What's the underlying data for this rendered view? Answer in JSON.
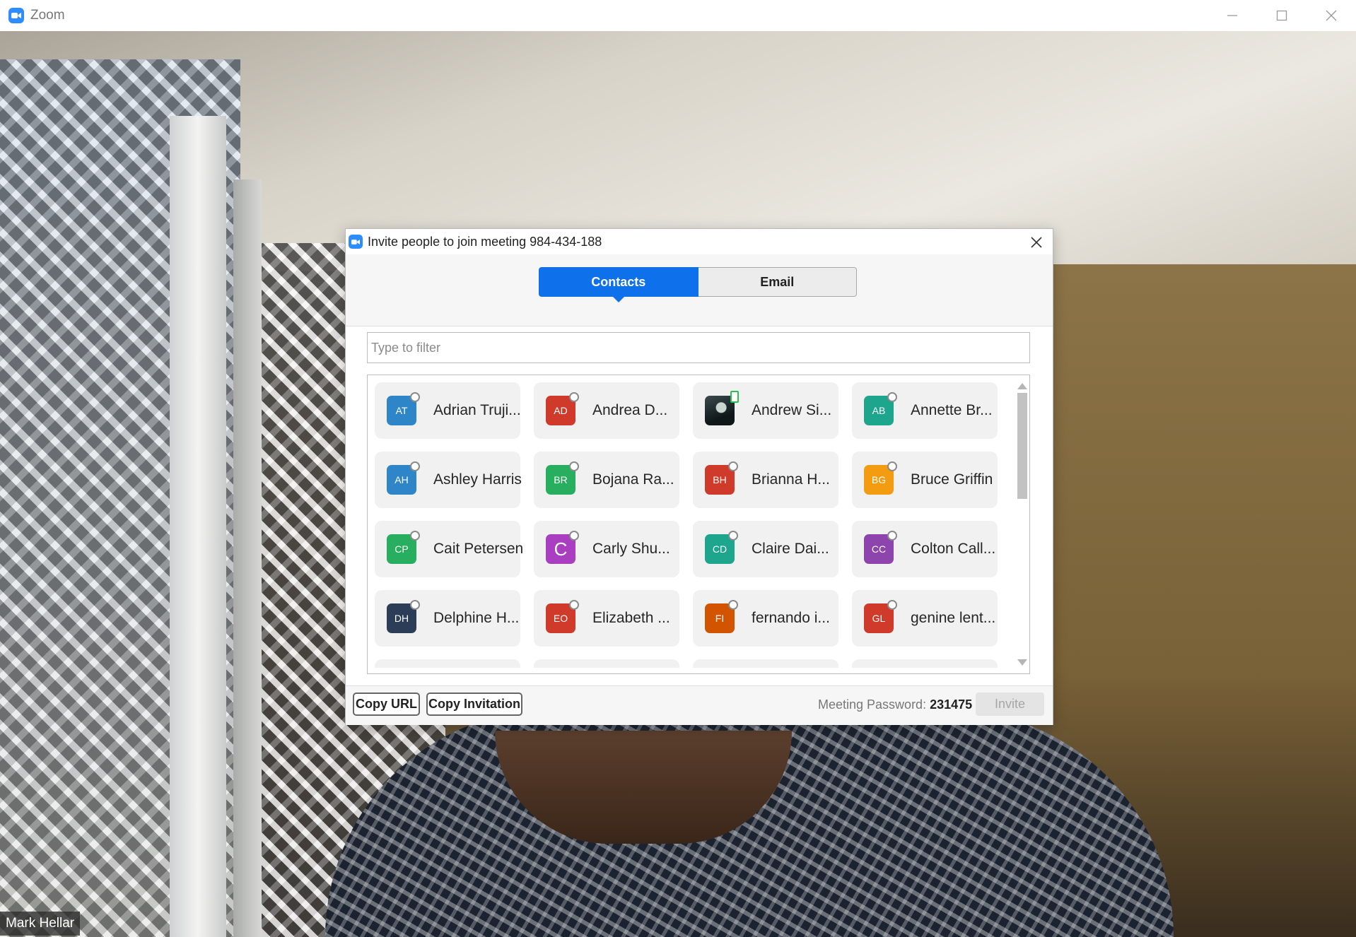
{
  "window": {
    "title": "Zoom"
  },
  "video": {
    "participant_name": "Mark Hellar"
  },
  "dialog": {
    "title": "Invite people to join meeting 984-434-188",
    "tabs": [
      {
        "label": "Contacts",
        "active": true
      },
      {
        "label": "Email",
        "active": false
      }
    ],
    "filter_placeholder": "Type to filter",
    "contacts": [
      {
        "name": "Adrian Truji...",
        "initials": "AT",
        "color": "#2e86c8",
        "presence": "offline"
      },
      {
        "name": "Andrea D...",
        "initials": "AD",
        "color": "#cf3a2a",
        "presence": "offline"
      },
      {
        "name": "Andrew Si...",
        "initials": "",
        "color": "#1b2a2e",
        "presence": "mobile",
        "photo": true
      },
      {
        "name": "Annette Br...",
        "initials": "AB",
        "color": "#1ea58d",
        "presence": "offline"
      },
      {
        "name": "Ashley Harris",
        "initials": "AH",
        "color": "#2e86c8",
        "presence": "offline"
      },
      {
        "name": "Bojana Ra...",
        "initials": "BR",
        "color": "#27ae5f",
        "presence": "offline"
      },
      {
        "name": "Brianna H...",
        "initials": "BH",
        "color": "#cf3a2a",
        "presence": "offline"
      },
      {
        "name": "Bruce Griffin",
        "initials": "BG",
        "color": "#f39c12",
        "presence": "offline"
      },
      {
        "name": "Cait Petersen",
        "initials": "CP",
        "color": "#27ae5f",
        "presence": "offline"
      },
      {
        "name": "Carly Shu...",
        "initials": "C",
        "color": "#a93fc0",
        "presence": "offline"
      },
      {
        "name": "Claire Dai...",
        "initials": "CD",
        "color": "#1ea58d",
        "presence": "offline"
      },
      {
        "name": "Colton Call...",
        "initials": "CC",
        "color": "#8e44ad",
        "presence": "offline"
      },
      {
        "name": "Delphine H...",
        "initials": "DH",
        "color": "#2c3e57",
        "presence": "offline"
      },
      {
        "name": "Elizabeth ...",
        "initials": "EO",
        "color": "#cf3a2a",
        "presence": "offline"
      },
      {
        "name": "fernando i...",
        "initials": "FI",
        "color": "#d35400",
        "presence": "offline"
      },
      {
        "name": "genine lent...",
        "initials": "GL",
        "color": "#cf3a2a",
        "presence": "offline"
      }
    ],
    "footer": {
      "copy_url_label": "Copy URL",
      "copy_invitation_label": "Copy Invitation",
      "password_label": "Meeting Password:",
      "password_value": "231475",
      "invite_label": "Invite"
    }
  }
}
